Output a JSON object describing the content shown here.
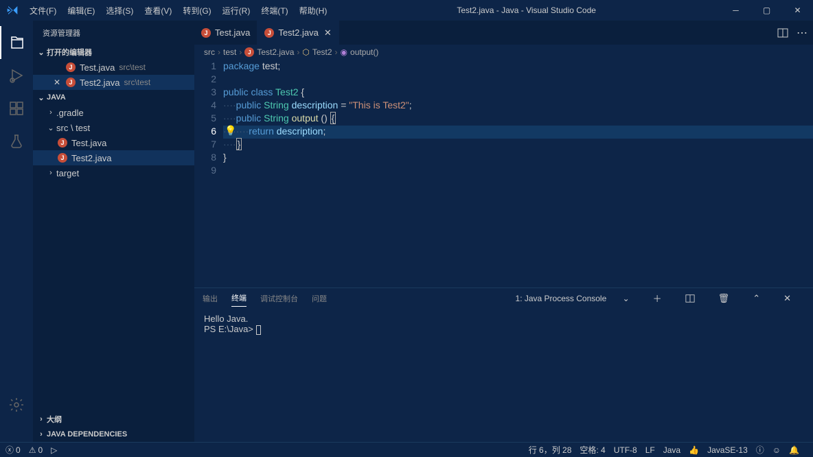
{
  "title": "Test2.java - Java - Visual Studio Code",
  "menu": [
    "文件(F)",
    "编辑(E)",
    "选择(S)",
    "查看(V)",
    "转到(G)",
    "运行(R)",
    "终端(T)",
    "帮助(H)"
  ],
  "sidebar": {
    "header": "资源管理器",
    "openEditors": "打开的编辑器",
    "javaSection": "JAVA",
    "gradle": ".gradle",
    "srcTest": "src \\ test",
    "target": "target",
    "outline": "大纲",
    "javaDeps": "JAVA DEPENDENCIES",
    "files": {
      "test1": "Test.java",
      "test2": "Test2.java",
      "test1path": "src\\test",
      "test2path": "src\\test"
    }
  },
  "tabs": {
    "t1": "Test.java",
    "t2": "Test2.java"
  },
  "breadcrumb": {
    "b1": "src",
    "b2": "test",
    "b3": "Test2.java",
    "b4": "Test2",
    "b5": "output()"
  },
  "code": {
    "l1a": "package",
    "l1b": " test;",
    "l3a": "public",
    "l3b": "class",
    "l3c": "Test2",
    "l3d": " {",
    "l4a": "public",
    "l4b": "String",
    "l4c": "description",
    "l4d": " = ",
    "l4e": "\"This is Test2\"",
    "l4f": ";",
    "l5a": "public",
    "l5b": "String",
    "l5c": "output",
    "l5d": " () ",
    "l6a": "return",
    "l6b": "description",
    "l6c": ";",
    "l8": "}"
  },
  "panel": {
    "tabs": {
      "output": "输出",
      "terminal": "终端",
      "debug": "调试控制台",
      "problems": "问题"
    },
    "selector": "1: Java Process Console",
    "line1": "Hello Java.",
    "line2": "PS E:\\Java> "
  },
  "status": {
    "errors": "0",
    "warnings": "0",
    "lncol": "行 6，列 28",
    "spaces": "空格: 4",
    "enc": "UTF-8",
    "eol": "LF",
    "lang": "Java",
    "jdk": "JavaSE-13"
  }
}
